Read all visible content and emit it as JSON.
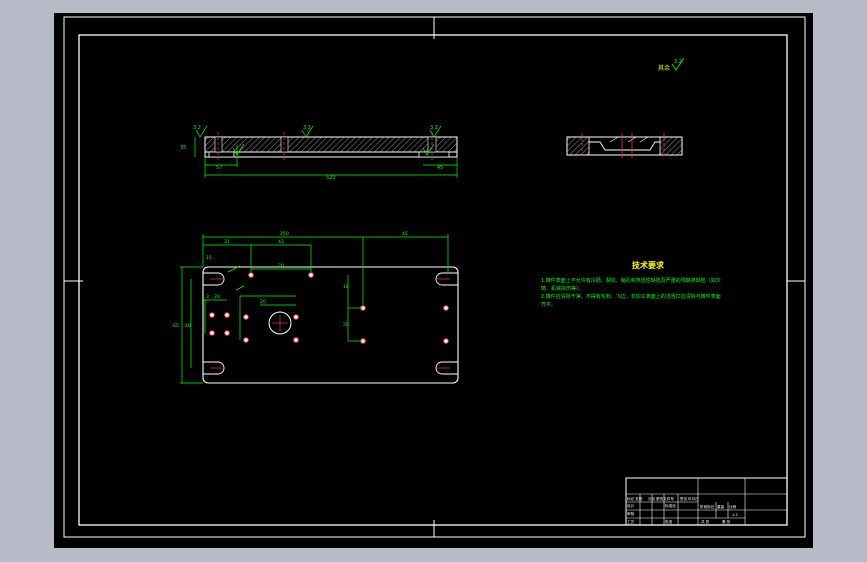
{
  "colors": {
    "frame": "#ffffff",
    "dimension": "#00ff00",
    "part": "#ffffff",
    "hole": "#ff3030",
    "centerline": "#ff3030",
    "hatch": "#ffffff",
    "tech_text": "#00ff00",
    "title": "#ffff00",
    "background": "#000000",
    "outer": "#b7bbc8"
  },
  "roughness": {
    "global_symbol": "3.2",
    "global_label": "其余",
    "front_left": "3.2",
    "front_mid": "3.2",
    "front_right": "3.2"
  },
  "front_view_dims": {
    "height": "35",
    "overall_length": "520",
    "left_offset": "57",
    "right_offset": "45"
  },
  "top_view_dims": {
    "top_overall": "250",
    "top_right": "45",
    "top_left_a": "31",
    "top_left_b": "43",
    "slot_w": "15",
    "hole_span": "20",
    "bore_dim": "20",
    "vert_overall": "65",
    "vert_mid": "40",
    "vert_small_a": "3",
    "vert_small_b": "20",
    "vert_right_a": "10",
    "vert_right_b": "20"
  },
  "tech": {
    "title": "技术要求",
    "line1": "1.铸件表面上不允许有冷隔、裂纹、缩孔和穿透性缺陷及严重的残缺类缺陷（如欠",
    "line2": "铸、机械损伤等）。",
    "line3": "2.铸件应清除干净，不得有毛刺、飞边，非加工表面上的浇冒口应清除与铸件表面",
    "line4": "齐平。"
  },
  "title_block": {
    "r1c1": "标记 处数",
    "r1c2": "分区",
    "r1c3": "更改文件号",
    "r1c4": "签名",
    "r1c5": "年月日",
    "r2c1": "设计",
    "r2c2": "标准化",
    "r3c1": "审核",
    "r4c1": "工艺",
    "r4c2": "批准",
    "stage": "阶段标记",
    "weight": "重量",
    "ratio": "比例",
    "ratio_val": "1:2",
    "sheet_total": "共  张",
    "sheet_no": "第  张"
  }
}
